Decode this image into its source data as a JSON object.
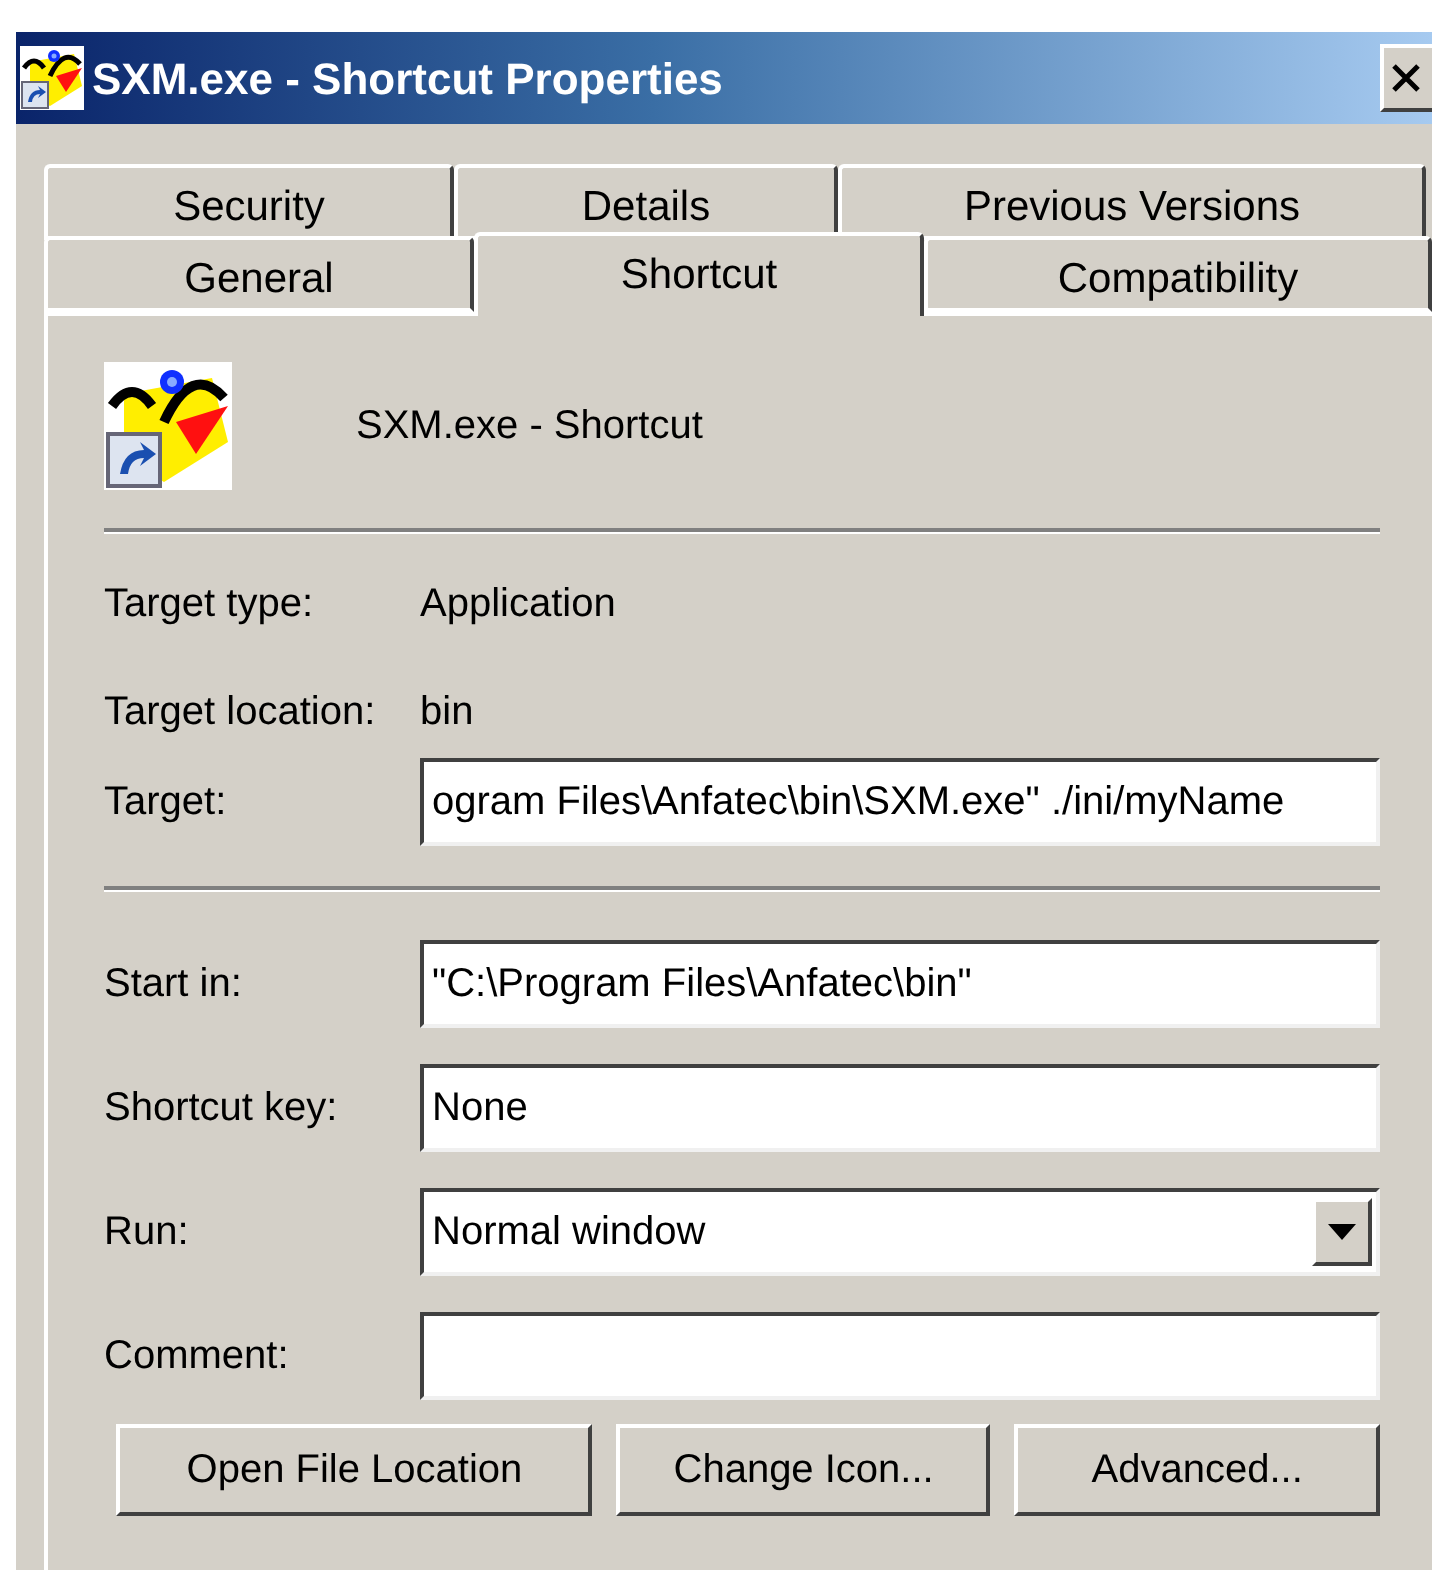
{
  "window": {
    "title": "SXM.exe - Shortcut Properties"
  },
  "tab_rows": [
    [
      {
        "label": "Security",
        "selected": false
      },
      {
        "label": "Details",
        "selected": false
      },
      {
        "label": "Previous Versions",
        "selected": false
      }
    ],
    [
      {
        "label": "General",
        "selected": false
      },
      {
        "label": "Shortcut",
        "selected": true
      },
      {
        "label": "Compatibility",
        "selected": false
      }
    ]
  ],
  "header": {
    "name": "SXM.exe - Shortcut"
  },
  "info": [
    {
      "label": "Target type:",
      "value": "Application"
    },
    {
      "label": "Target location:",
      "value": "bin"
    }
  ],
  "target": {
    "label": "Target:",
    "value": "ogram Files\\Anfatec\\bin\\SXM.exe\" ./ini/myName"
  },
  "fields": [
    {
      "kind": "text",
      "label": "Start in:",
      "value": "\"C:\\Program Files\\Anfatec\\bin\""
    },
    {
      "kind": "text",
      "label": "Shortcut key:",
      "value": "None"
    },
    {
      "kind": "dropdown",
      "label": "Run:",
      "value": "Normal window"
    },
    {
      "kind": "text",
      "label": "Comment:"
    }
  ],
  "buttons": [
    "Open File Location",
    "Change Icon...",
    "Advanced..."
  ]
}
